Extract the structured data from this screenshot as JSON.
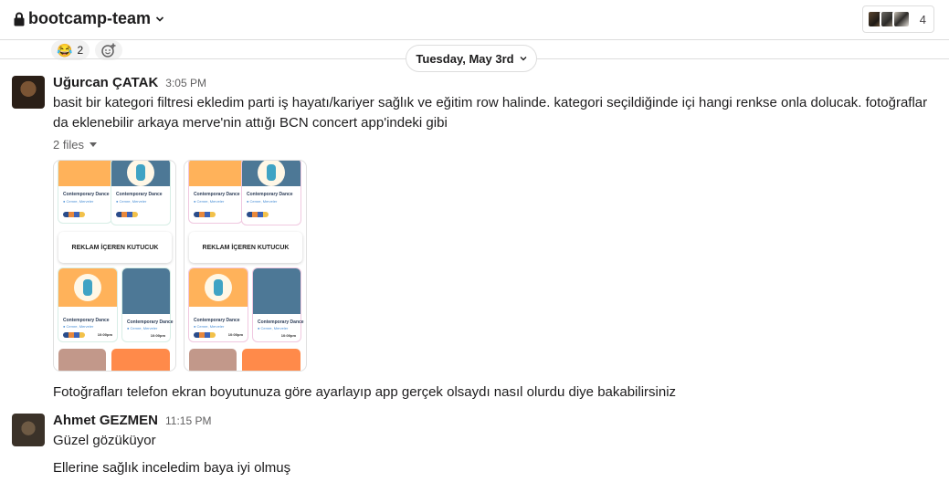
{
  "header": {
    "channel_name": "bootcamp-team",
    "member_count": "4",
    "lock_icon": "lock-icon",
    "chevron_icon": "chevron-down-icon"
  },
  "reactions": [
    {
      "emoji": "😂",
      "count": "2"
    }
  ],
  "date_divider": {
    "label": "Tuesday, May 3rd"
  },
  "messages": [
    {
      "author": "Uğurcan ÇATAK",
      "time": "3:05 PM",
      "text_line1": "basit bir kategori filtresi ekledim parti iş hayatı/kariyer sağlık ve eğitim row halinde. kategori seçildiğinde içi hangi renkse onla dolucak. fotoğraflar",
      "text_line2": "da eklenebilir arkaya merve'nin attığı BCN concert app'indeki gibi",
      "files_label": "2 files",
      "file_thumbs": [
        {
          "banner": "REKLAM İÇEREN KUTUCUK",
          "card_title": "Contemporary Dance",
          "card_sub": "● Cemre, Merveler",
          "card_time": "10:00pm"
        },
        {
          "banner": "REKLAM İÇEREN KUTUCUK",
          "card_title": "Contemporary Dance",
          "card_sub": "● Cemre, Merveler",
          "card_time": "10:00pm"
        }
      ],
      "followup": "Fotoğrafları telefon ekran boyutunuza göre ayarlayıp app gerçek olsaydı nasıl olurdu diye bakabilirsiniz"
    },
    {
      "author": "Ahmet GEZMEN",
      "time": "11:15 PM",
      "text_line1": "Güzel gözüküyor",
      "text_line2": "Ellerine sağlık inceledim baya iyi olmuş"
    }
  ],
  "colors": {
    "text": "#1d1c1d",
    "muted": "#616061",
    "border": "#dddddd"
  }
}
